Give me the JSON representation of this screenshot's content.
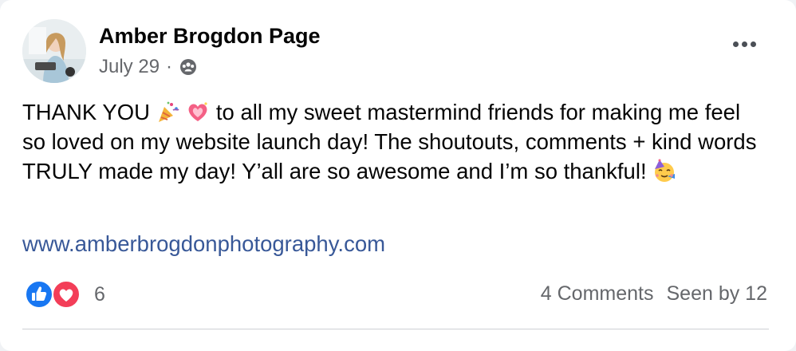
{
  "post": {
    "author": "Amber Brogdon Page",
    "date": "July 29",
    "separator": "·",
    "privacy_icon": "group-audience-icon",
    "message": {
      "part1": "THANK YOU",
      "part2": "to all my sweet mastermind friends for making me feel so loved on my website launch day! The shoutouts, comments + kind words TRULY made my day! Y’all are so awesome and I’m so thankful!"
    },
    "link": "www.amberbrogdonphotography.com",
    "reactions": {
      "icons": [
        "like-icon",
        "love-icon"
      ],
      "count": "6"
    },
    "comments": "4 Comments",
    "seen_by": "Seen by 12"
  }
}
